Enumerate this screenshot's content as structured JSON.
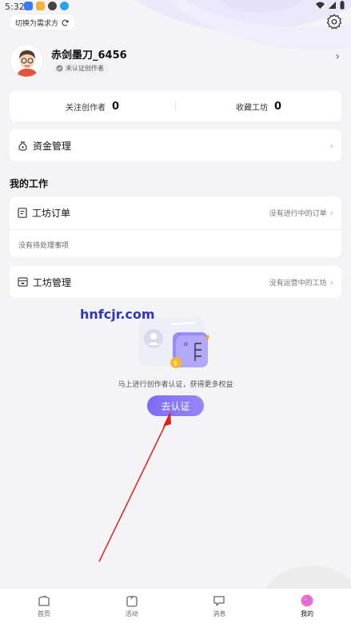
{
  "status_bar": {
    "time": "5:32"
  },
  "header": {
    "switch_label": "切换为需求方"
  },
  "profile": {
    "username": "赤剑墨刀_6456",
    "cert_status": "未认证创作者"
  },
  "stats": [
    {
      "label": "关注创作者",
      "value": "0"
    },
    {
      "label": "收藏工坊",
      "value": "0"
    }
  ],
  "funds": {
    "label": "资金管理"
  },
  "section": {
    "title": "我的工作"
  },
  "orders": {
    "label": "工坊订单",
    "status": "没有进行中的订单",
    "empty": "没有待处理事项"
  },
  "workshop": {
    "label": "工坊管理",
    "status": "没有运营中的工坊"
  },
  "watermark": "hnfcjr.com",
  "promo": {
    "text": "马上进行创作者认证，获得更多权益",
    "button": "去认证"
  },
  "tabs": [
    {
      "label": "首页",
      "icon": "home-icon"
    },
    {
      "label": "活动",
      "icon": "activity-icon"
    },
    {
      "label": "消息",
      "icon": "message-icon"
    },
    {
      "label": "我的",
      "icon": "profile-icon"
    }
  ],
  "colors": {
    "accent": "#7a6df5",
    "background": "#f4f4f6",
    "arrow": "#e02020"
  }
}
